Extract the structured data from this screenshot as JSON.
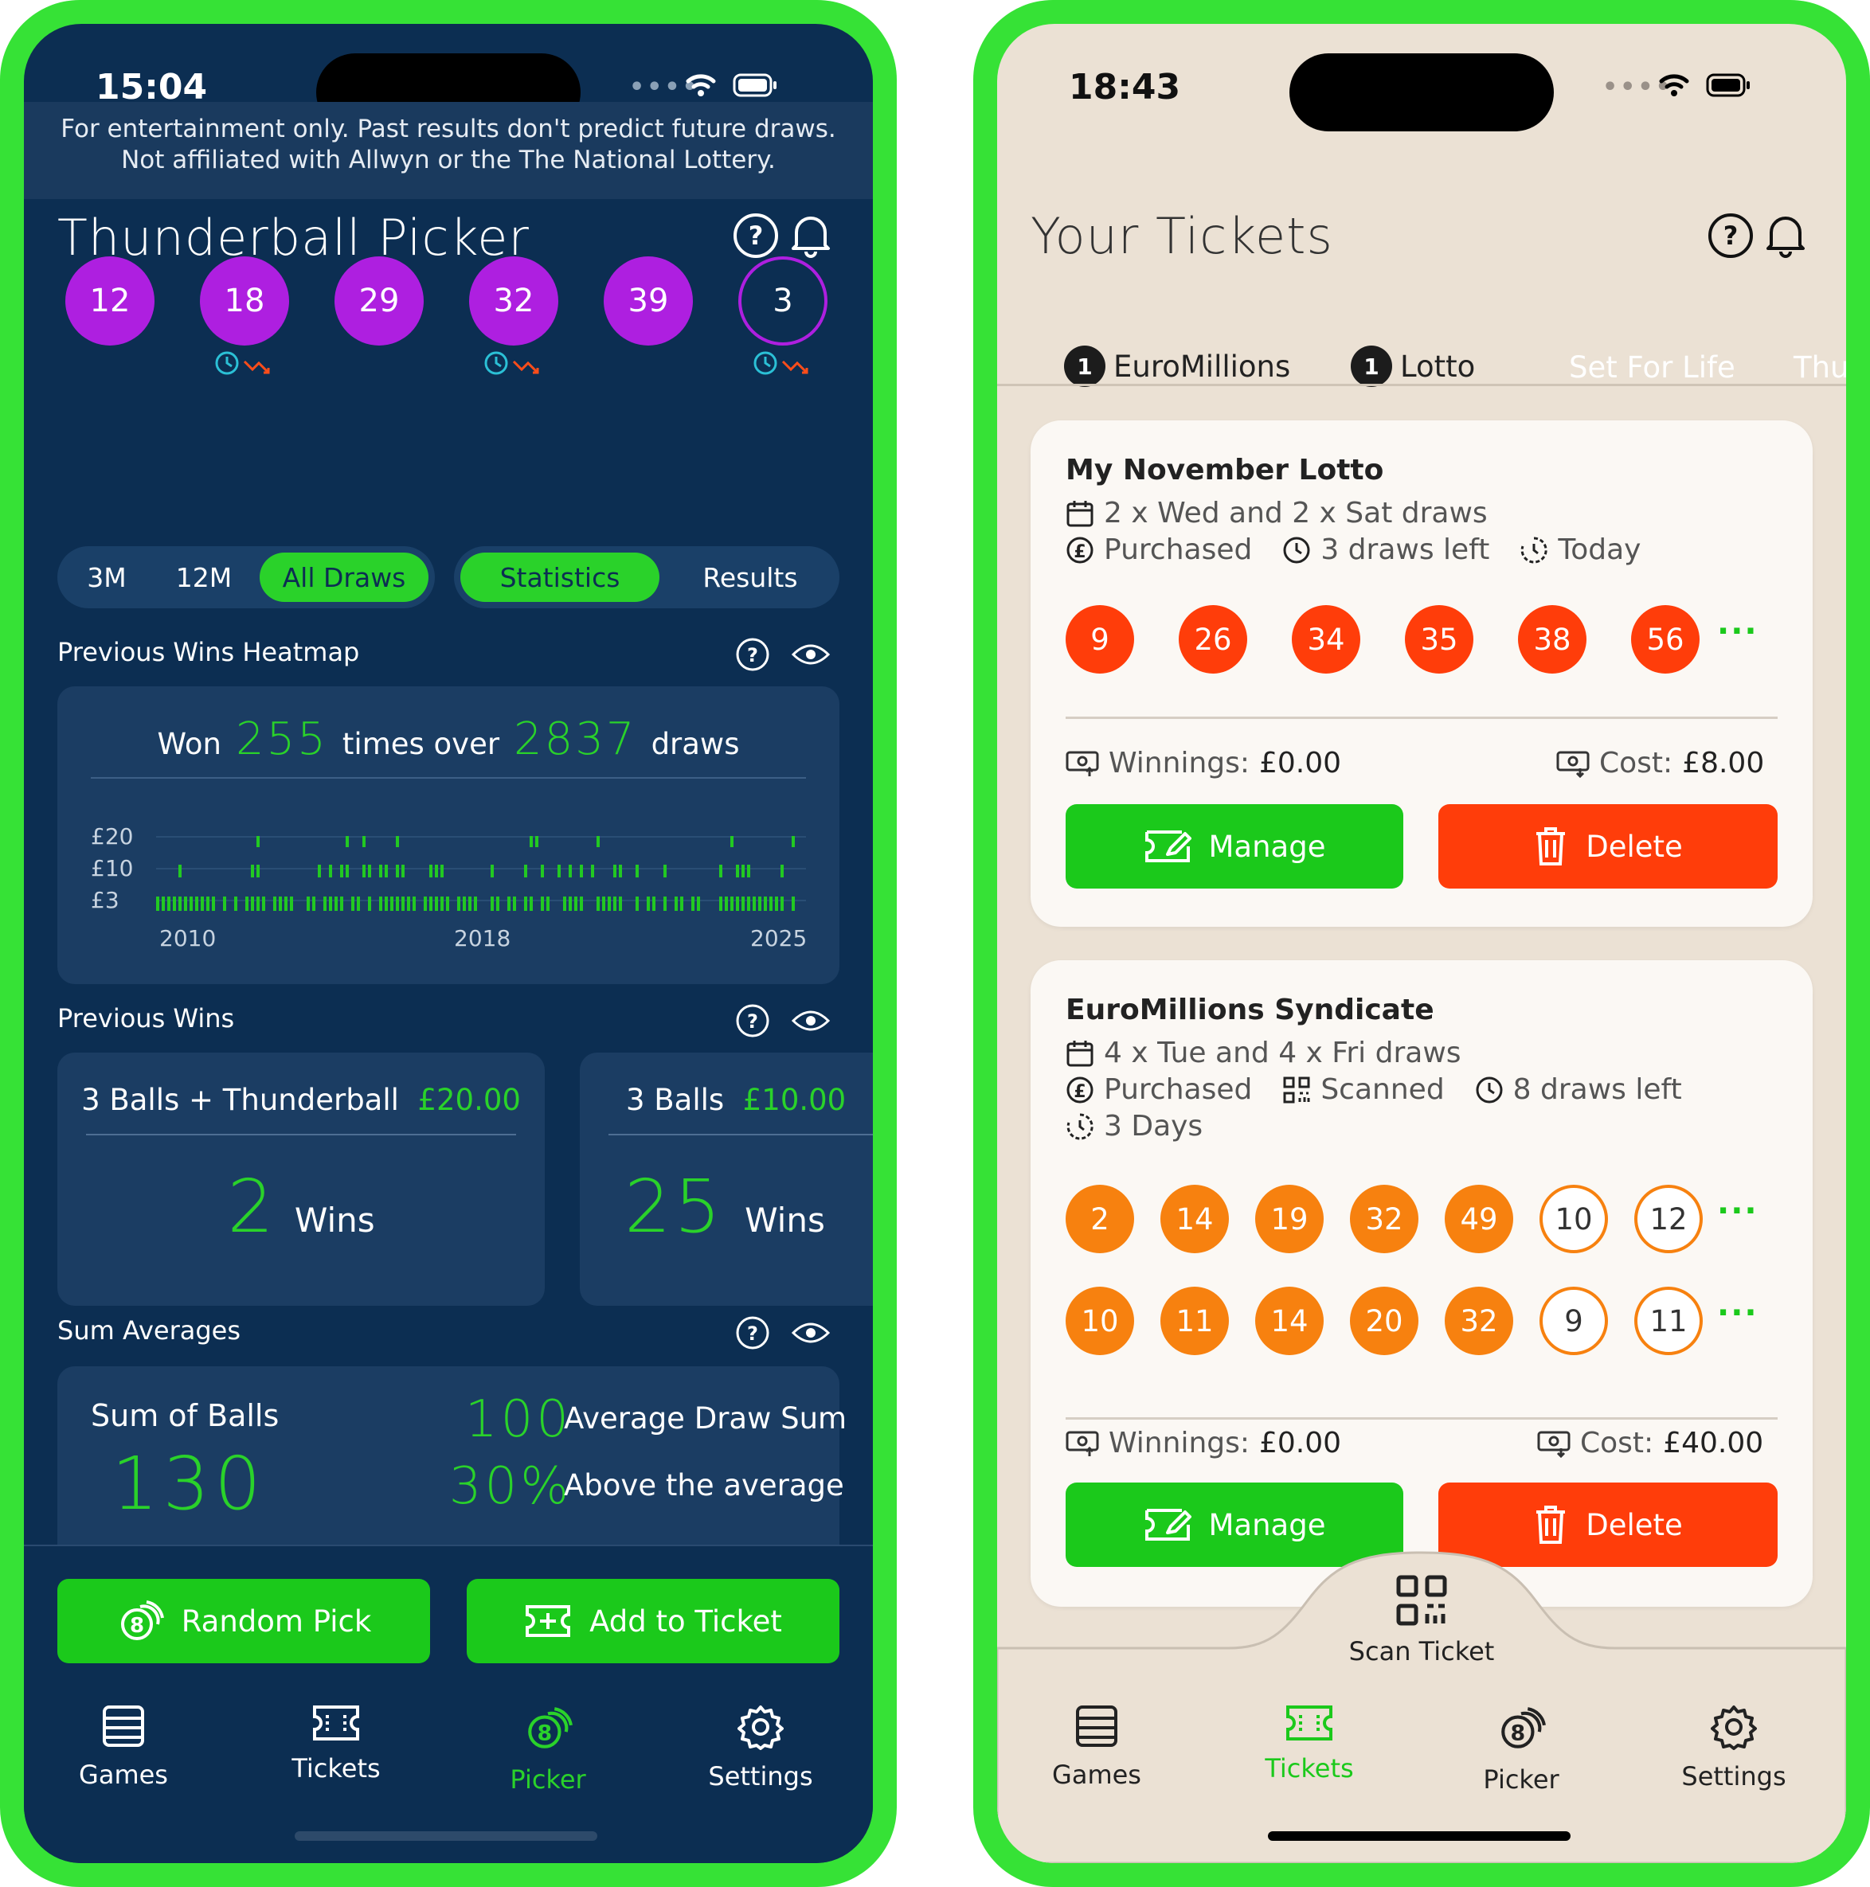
{
  "left_phone": {
    "status": {
      "time": "15:04"
    },
    "disclaimer": {
      "line1": "For entertainment only. Past results don't predict future draws.",
      "line2": "Not affiliated with Allwyn or the The National Lottery."
    },
    "title": "Thunderball Picker",
    "balls": [
      "12",
      "18",
      "29",
      "32",
      "39"
    ],
    "thunderball": "3",
    "period_tabs": [
      "3M",
      "12M",
      "All Draws"
    ],
    "period_active": "All Draws",
    "view_tabs": [
      "Statistics",
      "Results"
    ],
    "view_active": "Statistics",
    "heatmap": {
      "section_title": "Previous Wins Heatmap",
      "won_prefix": "Won",
      "won_count": "255",
      "won_mid": "times over",
      "draw_count": "2837",
      "won_suffix": "draws",
      "y_labels": [
        "£20",
        "£10",
        "£3"
      ],
      "x_labels": [
        "2010",
        "2018",
        "2025"
      ]
    },
    "previous_wins": {
      "section_title": "Previous Wins",
      "cards": [
        {
          "label": "3 Balls + Thunderball",
          "prize": "£20.00",
          "count": "2",
          "unit": "Wins"
        },
        {
          "label": "3 Balls",
          "prize": "£10.00",
          "count": "25",
          "unit": "Wins"
        }
      ]
    },
    "sum_averages": {
      "section_title": "Sum Averages",
      "sum_label": "Sum of Balls",
      "sum_value": "130",
      "avg_value": "100",
      "avg_label": "Average Draw Sum",
      "pct_value": "30%",
      "pct_label": "Above the average"
    },
    "actions": {
      "random_pick": "Random Pick",
      "add_to_ticket": "Add to Ticket"
    },
    "nav": {
      "items": [
        "Games",
        "Tickets",
        "Picker",
        "Settings"
      ],
      "active": "Picker"
    },
    "colors": {
      "accent": "#2ad22a",
      "ball": "#ae1fe0",
      "background": "#0c2e52"
    }
  },
  "right_phone": {
    "status": {
      "time": "18:43"
    },
    "title": "Your Tickets",
    "tabs": [
      {
        "badge": "1",
        "label": "EuroMillions"
      },
      {
        "badge": "1",
        "label": "Lotto"
      },
      {
        "badge": "",
        "label": "Set For Life"
      },
      {
        "badge": "",
        "label": "Thund"
      }
    ],
    "tickets": [
      {
        "name": "My November Lotto",
        "schedule": "2 x Wed and 2 x Sat draws",
        "purchased": "Purchased",
        "draws_left": "3 draws left",
        "next": "Today",
        "numbers": [
          "9",
          "26",
          "34",
          "35",
          "38",
          "56"
        ],
        "winnings_label": "Winnings:",
        "winnings": "£0.00",
        "cost_label": "Cost:",
        "cost": "£8.00",
        "manage": "Manage",
        "delete": "Delete"
      },
      {
        "name": "EuroMillions Syndicate",
        "schedule": "4 x Tue and 4 x Fri draws",
        "purchased": "Purchased",
        "scanned": "Scanned",
        "draws_left": "8 draws left",
        "next": "3 Days",
        "line1_main": [
          "2",
          "14",
          "19",
          "32",
          "49"
        ],
        "line1_stars": [
          "10",
          "12"
        ],
        "line2_main": [
          "10",
          "11",
          "14",
          "20",
          "32"
        ],
        "line2_stars": [
          "9",
          "11"
        ],
        "winnings_label": "Winnings:",
        "winnings": "£0.00",
        "cost_label": "Cost:",
        "cost": "£40.00",
        "manage": "Manage",
        "delete": "Delete"
      }
    ],
    "scan_ticket": "Scan Ticket",
    "nav": {
      "items": [
        "Games",
        "Tickets",
        "Picker",
        "Settings"
      ],
      "active": "Tickets"
    },
    "colors": {
      "accent": "#2ad22a",
      "danger": "#ff3d0a",
      "lotto_ball": "#ff3d0a",
      "euro_ball": "#f7810f",
      "background": "#ebe1d4"
    }
  }
}
